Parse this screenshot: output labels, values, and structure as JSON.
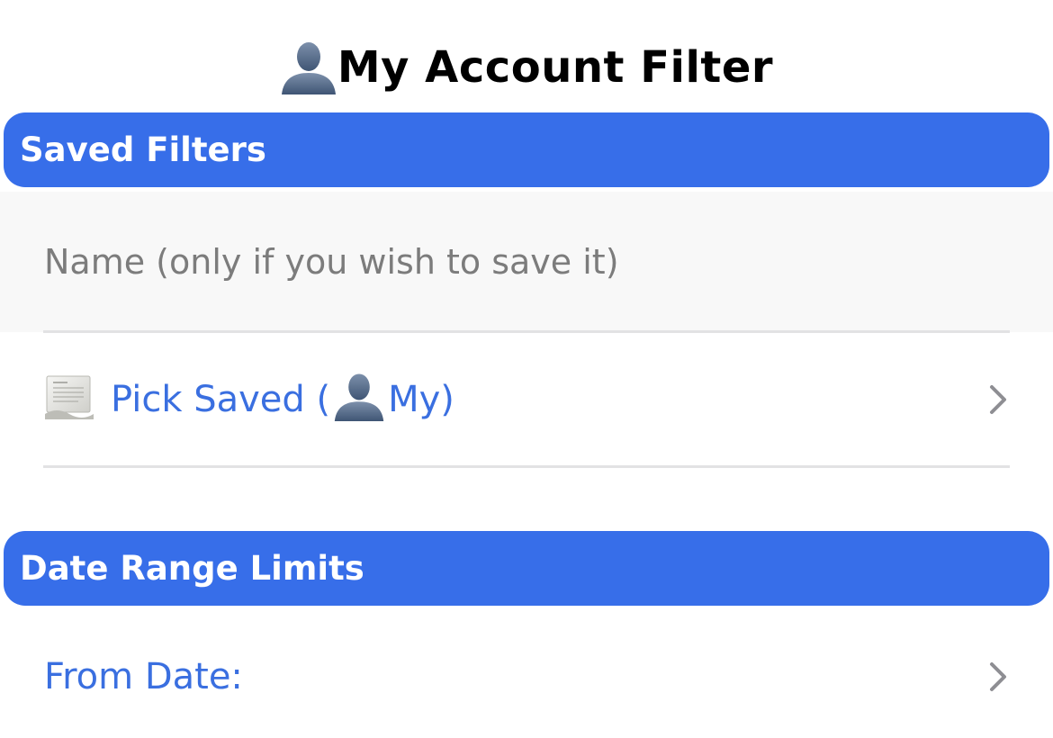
{
  "header": {
    "title": "My Account Filter",
    "title_icon": "person-silhouette-icon"
  },
  "sections": {
    "saved_filters": {
      "header_label": "Saved Filters",
      "name_field": {
        "placeholder": "Name (only if you wish to save it)",
        "value": ""
      },
      "pick_saved": {
        "icon": "scroll-document-icon",
        "label_prefix": "Pick Saved (",
        "label_icon": "person-silhouette-icon",
        "label_suffix": "My)"
      }
    },
    "date_range": {
      "header_label": "Date Range Limits",
      "from_date": {
        "label": "From Date:"
      }
    }
  },
  "colors": {
    "accent": "#376ee9",
    "link": "#3a6fe0",
    "chevron": "#8e8e93",
    "field_bg": "#f8f8f8",
    "divider": "#e2e2e4"
  }
}
